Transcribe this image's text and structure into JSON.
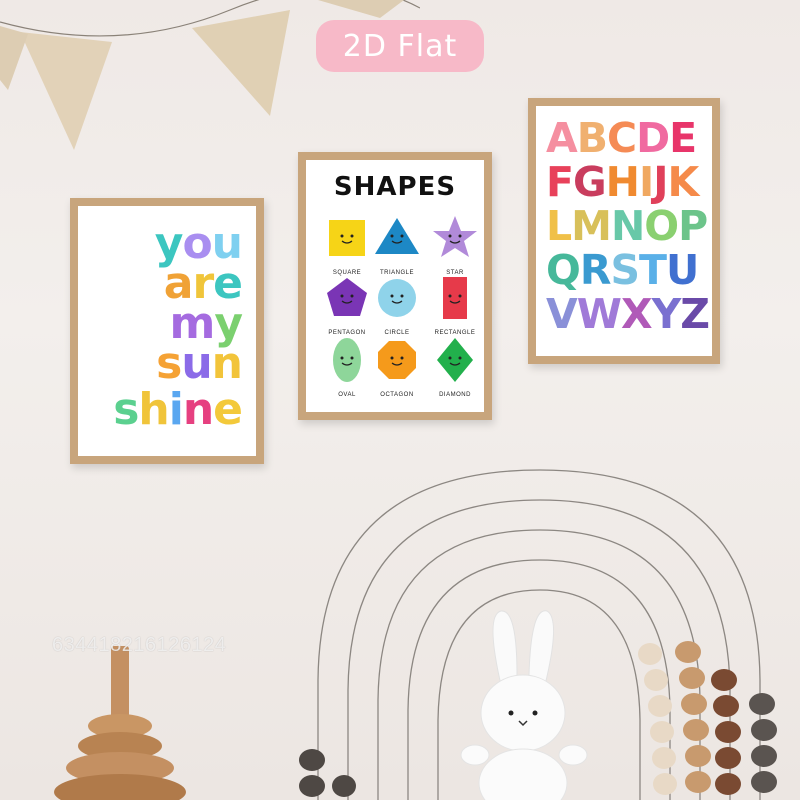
{
  "badge": {
    "label": "2D Flat"
  },
  "poster_sunshine": {
    "lines": [
      {
        "letters": [
          {
            "c": "y",
            "color": "#3cc6c0"
          },
          {
            "c": "o",
            "color": "#a98ef0"
          },
          {
            "c": "u",
            "color": "#7fd0f0"
          }
        ]
      },
      {
        "letters": [
          {
            "c": "a",
            "color": "#f0a236"
          },
          {
            "c": "r",
            "color": "#f0c53a"
          },
          {
            "c": "e",
            "color": "#3cc6c0"
          }
        ]
      },
      {
        "letters": [
          {
            "c": "m",
            "color": "#a56be0"
          },
          {
            "c": "y",
            "color": "#7bd06f"
          }
        ]
      },
      {
        "letters": [
          {
            "c": "s",
            "color": "#f5a235"
          },
          {
            "c": "u",
            "color": "#8b6be8"
          },
          {
            "c": "n",
            "color": "#f2c43a"
          }
        ]
      },
      {
        "letters": [
          {
            "c": "s",
            "color": "#5bd08f"
          },
          {
            "c": "h",
            "color": "#f0c43a"
          },
          {
            "c": "i",
            "color": "#5aa7f0"
          },
          {
            "c": "n",
            "color": "#e64080"
          },
          {
            "c": "e",
            "color": "#f3c93a"
          }
        ]
      }
    ]
  },
  "poster_shapes": {
    "title": "SHAPES",
    "items": [
      {
        "name": "SQUARE",
        "color": "#f6d417",
        "kind": "square"
      },
      {
        "name": "TRIANGLE",
        "color": "#1d88c5",
        "kind": "triangle"
      },
      {
        "name": "STAR",
        "color": "#b18ad9",
        "kind": "star"
      },
      {
        "name": "PENTAGON",
        "color": "#7a35b5",
        "kind": "pentagon"
      },
      {
        "name": "CIRCLE",
        "color": "#8fd3ea",
        "kind": "circle"
      },
      {
        "name": "RECTANGLE",
        "color": "#e63a4a",
        "kind": "rectangle"
      },
      {
        "name": "OVAL",
        "color": "#8ed69a",
        "kind": "oval"
      },
      {
        "name": "OCTAGON",
        "color": "#f59a1b",
        "kind": "octagon"
      },
      {
        "name": "DIAMOND",
        "color": "#22b04c",
        "kind": "diamond"
      }
    ]
  },
  "poster_alphabet": {
    "rows": [
      [
        {
          "c": "A",
          "color": "#f58fa0"
        },
        {
          "c": "B",
          "color": "#f0b070"
        },
        {
          "c": "C",
          "color": "#f58b55"
        },
        {
          "c": "D",
          "color": "#f06aa0"
        },
        {
          "c": "E",
          "color": "#e8356a"
        }
      ],
      [
        {
          "c": "F",
          "color": "#e8415a"
        },
        {
          "c": "G",
          "color": "#c93d5e"
        },
        {
          "c": "H",
          "color": "#f08a30"
        },
        {
          "c": "I",
          "color": "#f0a860"
        },
        {
          "c": "J",
          "color": "#e0405a"
        },
        {
          "c": "K",
          "color": "#f58a4a"
        }
      ],
      [
        {
          "c": "L",
          "color": "#f0c048"
        },
        {
          "c": "M",
          "color": "#d8c05a"
        },
        {
          "c": "N",
          "color": "#68c8a8"
        },
        {
          "c": "O",
          "color": "#8ad070"
        },
        {
          "c": "P",
          "color": "#6cc48a"
        }
      ],
      [
        {
          "c": "Q",
          "color": "#46b89a"
        },
        {
          "c": "R",
          "color": "#3a9ad0"
        },
        {
          "c": "S",
          "color": "#7ac0e0"
        },
        {
          "c": "T",
          "color": "#5ab0e8"
        },
        {
          "c": "U",
          "color": "#4070d0"
        }
      ],
      [
        {
          "c": "V",
          "color": "#8a90d8"
        },
        {
          "c": "W",
          "color": "#a07ad8"
        },
        {
          "c": "X",
          "color": "#b05ab8"
        },
        {
          "c": "Y",
          "color": "#7a70d0"
        },
        {
          "c": "Z",
          "color": "#6a4aa8"
        }
      ]
    ]
  },
  "watermark": {
    "text": "634418216126124"
  },
  "icons": [
    "bunting-flags",
    "rainbow-arch",
    "bunny-plush",
    "stacking-rings-toy",
    "abacus-beads"
  ]
}
